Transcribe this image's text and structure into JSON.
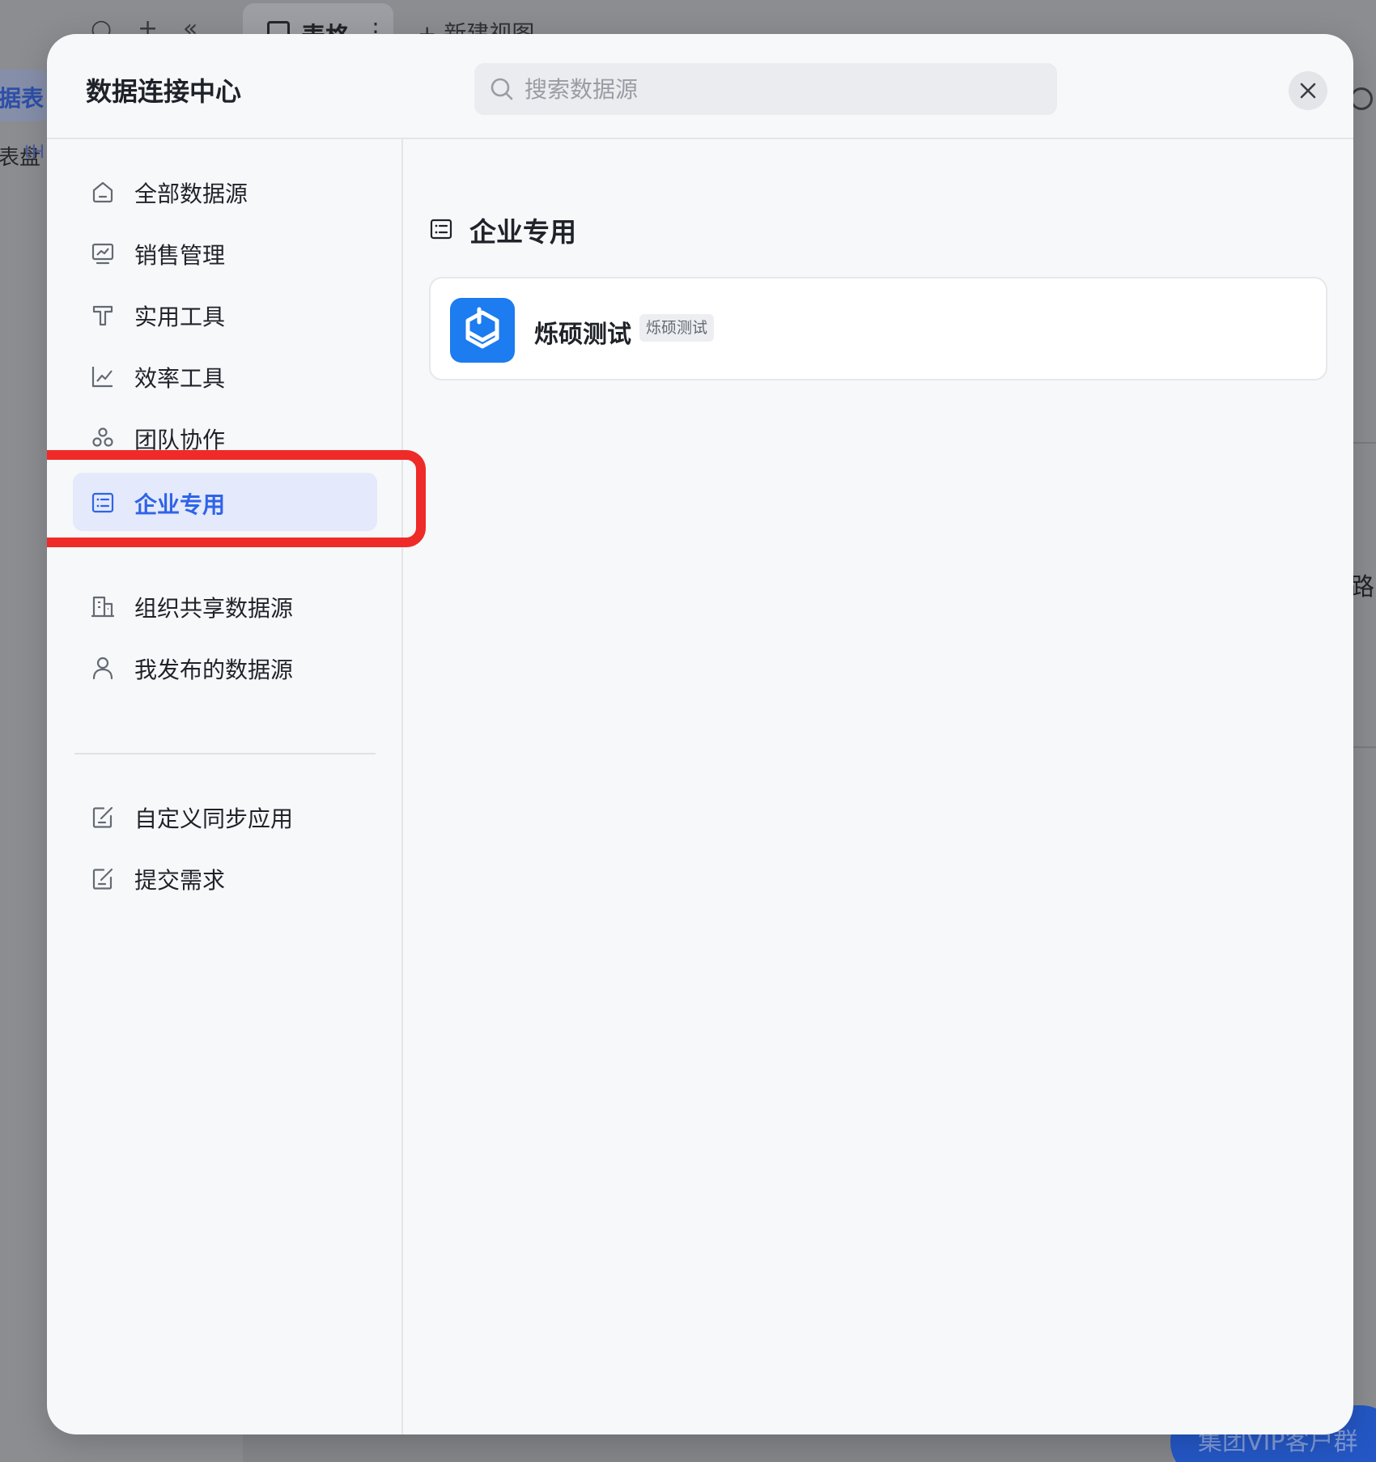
{
  "background": {
    "tab_label": "表格",
    "tab_more": "⋮",
    "new_view_label": "+ 新建视图",
    "left_item_1": "据表",
    "left_item_2": "表盘",
    "left_item_2_extra": "tH",
    "right_partial_char": "路",
    "vip_label": "集团VIP客户群"
  },
  "modal": {
    "title": "数据连接中心",
    "search": {
      "placeholder": "搜索数据源",
      "value": ""
    },
    "close_icon": "close-icon"
  },
  "sidebar": {
    "items": [
      {
        "label": "全部数据源",
        "icon": "home-icon",
        "active": false
      },
      {
        "label": "销售管理",
        "icon": "chart-screen-icon",
        "active": false
      },
      {
        "label": "实用工具",
        "icon": "hammer-icon",
        "active": false
      },
      {
        "label": "效率工具",
        "icon": "line-chart-icon",
        "active": false
      },
      {
        "label": "团队协作",
        "icon": "team-icon",
        "active": false
      },
      {
        "label": "企业专用",
        "icon": "list-icon",
        "active": true
      },
      {
        "label": "组织共享数据源",
        "icon": "building-icon",
        "active": false
      },
      {
        "label": "我发布的数据源",
        "icon": "user-icon",
        "active": false
      },
      {
        "label": "自定义同步应用",
        "icon": "edit-icon",
        "active": false
      },
      {
        "label": "提交需求",
        "icon": "edit-icon",
        "active": false
      }
    ]
  },
  "content": {
    "section_title": "企业专用",
    "cards": [
      {
        "name": "烁硕测试",
        "tag": "烁硕测试",
        "logo_color": "#1c7cf0"
      }
    ]
  },
  "colors": {
    "accent": "#2f64e8",
    "active_bg": "#e4e9fb",
    "highlight": "#ee2b28"
  }
}
